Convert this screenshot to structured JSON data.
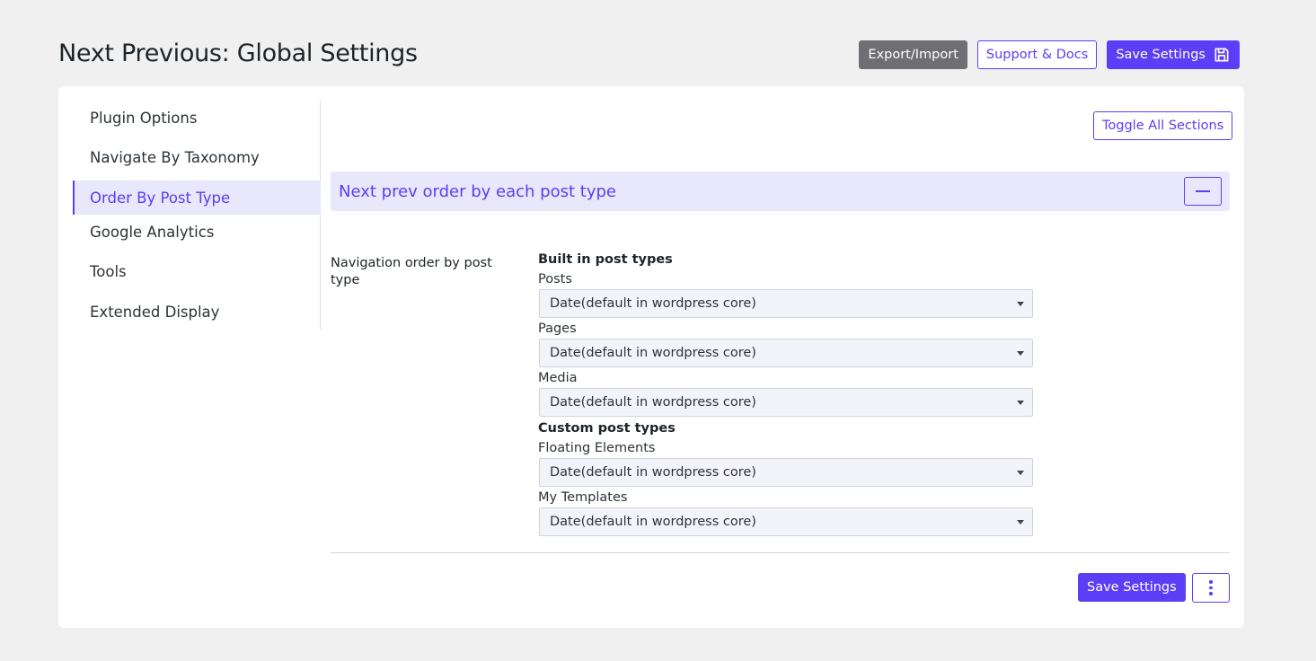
{
  "page": {
    "title": "Next Previous: Global Settings"
  },
  "header_actions": {
    "export_import": "Export/Import",
    "support_docs": "Support & Docs",
    "save_settings": "Save Settings"
  },
  "sidebar": {
    "items": [
      {
        "label": "Plugin Options"
      },
      {
        "label": "Navigate By Taxonomy"
      },
      {
        "label": "Order By Post Type",
        "active": true
      },
      {
        "label": "Google Analytics"
      },
      {
        "label": "Tools"
      },
      {
        "label": "Extended Display"
      }
    ]
  },
  "main": {
    "toggle_all": "Toggle All Sections",
    "section_title": "Next prev order by each post type",
    "field_label": "Navigation order by post type",
    "built_in_heading": "Built in post types",
    "custom_heading": "Custom post types",
    "selects": [
      {
        "label": "Posts",
        "value": "Date(default in wordpress core)"
      },
      {
        "label": "Pages",
        "value": "Date(default in wordpress core)"
      },
      {
        "label": "Media",
        "value": "Date(default in wordpress core)"
      },
      {
        "label": "Floating Elements",
        "value": "Date(default in wordpress core)"
      },
      {
        "label": "My Templates",
        "value": "Date(default in wordpress core)"
      }
    ],
    "bottom_save": "Save Settings"
  },
  "colors": {
    "accent": "#5b3ef5",
    "accent_bg": "#e8e7fb",
    "gray_button": "#6f6e73",
    "page_bg": "#f0f0f1"
  },
  "icons": {
    "save": "floppy-disk-icon",
    "collapse": "minus-icon",
    "more": "vertical-dots-icon",
    "select_caret": "caret-down-icon"
  }
}
